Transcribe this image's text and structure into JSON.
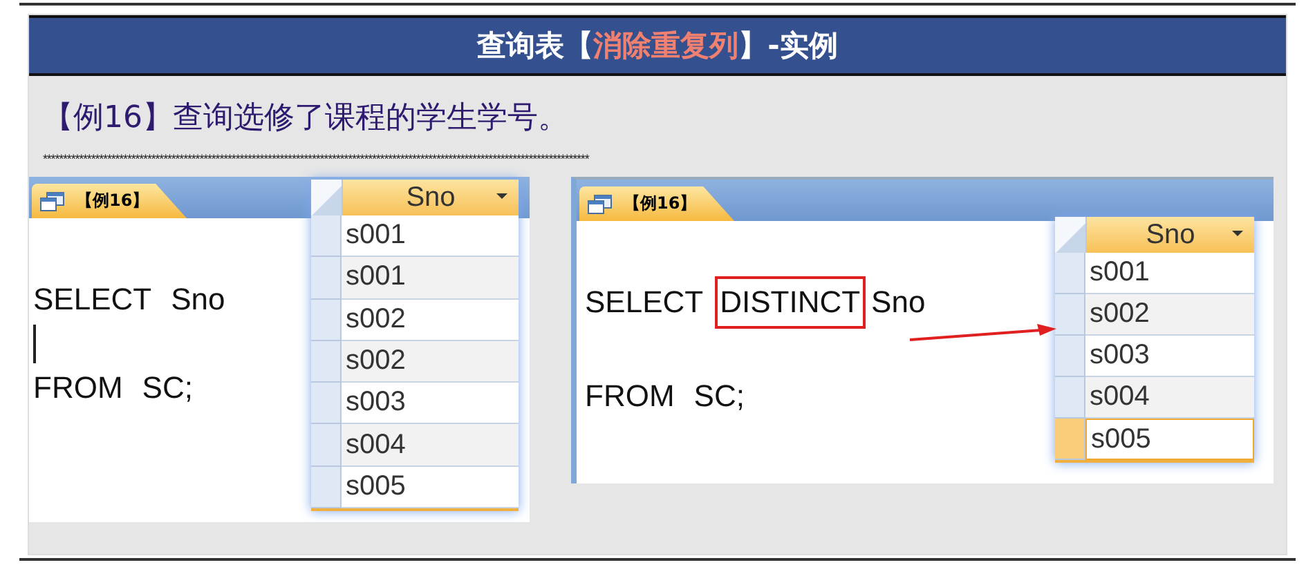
{
  "title": [
    {
      "text": "查询表【",
      "kind": "plain"
    },
    {
      "text": "消除重复列",
      "kind": "highlight"
    },
    {
      "text": "】-实例",
      "kind": "plain"
    }
  ],
  "subtitle": "【例16】查询选修了课程的学生学号。",
  "separator": "****************************************************************************************************************************************",
  "panels": [
    {
      "tab": "【例16】",
      "cursor": true,
      "arrow": false,
      "sql_lines": [
        [
          {
            "text": "SELECT",
            "boxed": false
          },
          {
            "text": "Sno",
            "boxed": false
          }
        ],
        [
          {
            "text": "FROM",
            "boxed": false
          },
          {
            "text": "SC;",
            "boxed": false
          }
        ]
      ],
      "grid": {
        "column": "Sno",
        "rows": [
          {
            "value": "s001",
            "selected": false
          },
          {
            "value": "s001",
            "selected": false
          },
          {
            "value": "s002",
            "selected": false
          },
          {
            "value": "s002",
            "selected": false
          },
          {
            "value": "s003",
            "selected": false
          },
          {
            "value": "s004",
            "selected": false
          },
          {
            "value": "s005",
            "selected": false
          }
        ]
      }
    },
    {
      "tab": "【例16】",
      "cursor": false,
      "arrow": true,
      "sql_lines": [
        [
          {
            "text": "SELECT",
            "boxed": false
          },
          {
            "text": "DISTINCT",
            "boxed": true
          },
          {
            "text": "Sno",
            "boxed": false
          }
        ],
        [
          {
            "text": "FROM",
            "boxed": false
          },
          {
            "text": "SC;",
            "boxed": false
          }
        ]
      ],
      "grid": {
        "column": "Sno",
        "rows": [
          {
            "value": "s001",
            "selected": false
          },
          {
            "value": "s002",
            "selected": false
          },
          {
            "value": "s003",
            "selected": false
          },
          {
            "value": "s004",
            "selected": false
          },
          {
            "value": "s005",
            "selected": true
          }
        ]
      }
    }
  ]
}
